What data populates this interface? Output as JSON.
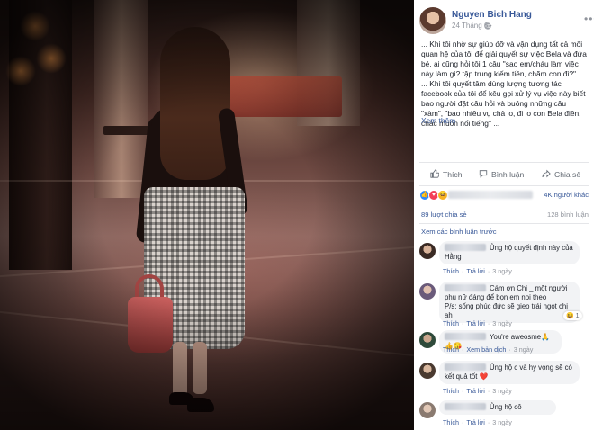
{
  "photo": {
    "description_label": ""
  },
  "post": {
    "author": "Nguyen Bich Hang",
    "date": "24 Tháng 6 ·",
    "globe_icon": "globe-icon",
    "text_lines": [
      "... Khi tôi nhờ sự giúp đỡ và vận dụng tất cả mối quan hệ của tôi để giải quyết sự việc Bela và đứa bé, ai cũng hỏi tôi 1 câu \"sao em/cháu làm việc này làm gì? tập trung kiếm tiền, chăm con đi?\"",
      "... Khi tôi quyết tâm dùng lượng tương tác facebook của tôi để kêu gọi xử lý vụ việc này biết bao người đặt câu hỏi và buông những câu \"xàm\", \"bao nhiêu vụ chả lo, đi lo con Bela điên, chắc muốn nổi tiếng\" ..."
    ],
    "see_more": "Xem thêm"
  },
  "actions": {
    "like": "Thích",
    "comment": "Bình luận",
    "share": "Chia sẻ"
  },
  "reactions": {
    "others_count": "4K người khác",
    "shares": "89 lượt chia sẻ",
    "views": "128 bình luận"
  },
  "comments_section": {
    "view_previous": "Xem các bình luận trước"
  },
  "comments": [
    {
      "text": "Ủng hộ quyết định này của Hằng",
      "like": "Thích",
      "reply": "Trả lời",
      "time": "3 ngày"
    },
    {
      "text": "Cám ơn Chị _ một người phụ nữ đáng để bọn em noi theo",
      "text2": "P/s: sống phúc đức sẽ gieo trái ngọt chị ah",
      "like": "Thích",
      "reply": "Trả lời",
      "time": "3 ngày",
      "reaction": "1"
    },
    {
      "text": "You're aweosme🙏👍😘",
      "like": "Thích",
      "reply": "Xem bản dịch",
      "time": "3 ngày"
    },
    {
      "text": "Ủng hộ c và hy vọng sẽ có kết quả tốt ❤️",
      "like": "Thích",
      "reply": "Trả lời",
      "time": "3 ngày"
    },
    {
      "text": "Ủng hộ cô",
      "like": "Thích",
      "reply": "Trả lời",
      "time": "3 ngày"
    }
  ],
  "colors": {
    "link": "#385898",
    "muted": "#90949c",
    "bubble": "#f2f3f5"
  }
}
